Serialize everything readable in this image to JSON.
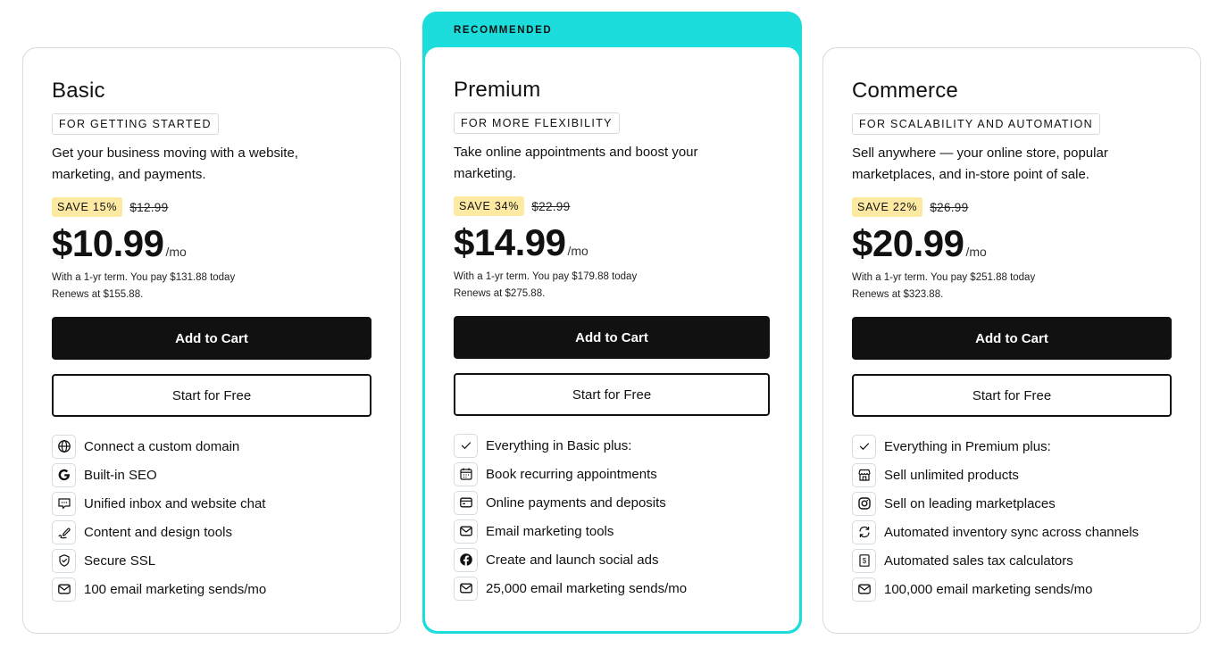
{
  "recommended_label": "RECOMMENDED",
  "accent_color": "#1ddcdc",
  "plans": [
    {
      "name": "Basic",
      "tagline": "FOR GETTING STARTED",
      "description": "Get your business moving with a website, marketing, and payments.",
      "save_badge": "SAVE 15%",
      "old_price": "$12.99",
      "price": "$10.99",
      "per": "/mo",
      "term_line1": "With a 1-yr term. You pay $131.88 today",
      "term_line2": "Renews at $155.88.",
      "primary_button": "Add to Cart",
      "secondary_button": "Start for Free",
      "features": [
        {
          "icon": "globe-icon",
          "text": "Connect a custom domain"
        },
        {
          "icon": "google-icon",
          "text": "Built-in SEO"
        },
        {
          "icon": "chat-icon",
          "text": "Unified inbox and website chat"
        },
        {
          "icon": "pen-icon",
          "text": "Content and design tools"
        },
        {
          "icon": "shield-icon",
          "text": "Secure SSL"
        },
        {
          "icon": "mail-icon",
          "text": "100 email marketing sends/mo"
        }
      ]
    },
    {
      "name": "Premium",
      "tagline": "FOR MORE FLEXIBILITY",
      "description": "Take online appointments and boost your marketing.",
      "save_badge": "SAVE 34%",
      "old_price": "$22.99",
      "price": "$14.99",
      "per": "/mo",
      "term_line1": "With a 1-yr term. You pay $179.88 today",
      "term_line2": "Renews at $275.88.",
      "primary_button": "Add to Cart",
      "secondary_button": "Start for Free",
      "features": [
        {
          "icon": "check-icon",
          "text": "Everything in Basic plus:"
        },
        {
          "icon": "calendar-icon",
          "text": "Book recurring appointments"
        },
        {
          "icon": "card-icon",
          "text": "Online payments and deposits"
        },
        {
          "icon": "mail-icon",
          "text": "Email marketing tools"
        },
        {
          "icon": "facebook-icon",
          "text": "Create and launch social ads"
        },
        {
          "icon": "mail-icon",
          "text": "25,000 email marketing sends/mo"
        }
      ]
    },
    {
      "name": "Commerce",
      "tagline": "FOR SCALABILITY AND AUTOMATION",
      "description": "Sell anywhere — your online store, popular marketplaces, and in-store point of sale.",
      "save_badge": "SAVE 22%",
      "old_price": "$26.99",
      "price": "$20.99",
      "per": "/mo",
      "term_line1": "With a 1-yr term. You pay $251.88 today",
      "term_line2": "Renews at $323.88.",
      "primary_button": "Add to Cart",
      "secondary_button": "Start for Free",
      "features": [
        {
          "icon": "check-icon",
          "text": "Everything in Premium plus:"
        },
        {
          "icon": "storefront-icon",
          "text": "Sell unlimited products"
        },
        {
          "icon": "instagram-icon",
          "text": "Sell on leading marketplaces"
        },
        {
          "icon": "sync-icon",
          "text": "Automated inventory sync across channels"
        },
        {
          "icon": "tax-icon",
          "text": "Automated sales tax calculators"
        },
        {
          "icon": "mail-icon",
          "text": "100,000 email marketing sends/mo"
        }
      ]
    }
  ]
}
